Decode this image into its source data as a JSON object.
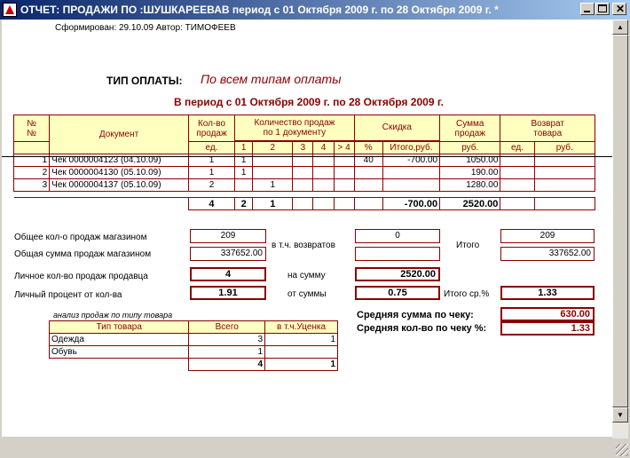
{
  "window": {
    "title": "ОТЧЕТ: ПРОДАЖИ ПО :ШУШКАРЕЕВАВ период с 01 Октября 2009 г. по 28 Октября 2009 г.  *",
    "min_glyph": "",
    "max_glyph": "",
    "close_glyph": "✕"
  },
  "report": {
    "meta": "Сформирован: 29.10.09 Автор: ТИМОФЕЕВ",
    "payment_label": "ТИП ОПЛАТЫ:",
    "payment_value": "По всем типам оплаты",
    "period": "В период с 01 Октября 2009 г. по 28 Октября 2009 г."
  },
  "sales_table": {
    "headers": {
      "num": "№\n№",
      "document": "Документ",
      "qty": "Кол-во\nпродаж",
      "sales_per_doc": "Количество продаж\nпо 1 документу",
      "discount": "Скидка",
      "sum": "Сумма\nпродаж",
      "returns": "Возврат\nтовара"
    },
    "subheaders": {
      "qty_unit": "ед.",
      "p1": "1",
      "p2": "2",
      "p3": "3",
      "p4": "4",
      "p5": "> 4",
      "disc_pct": "%",
      "disc_total": "Итого,руб.",
      "sum_unit": "руб.",
      "ret_unit": "ед.",
      "ret_rub": "руб."
    },
    "rows": [
      {
        "n": "1",
        "doc": "Чек 0000004123 (04.10.09)",
        "qty": "1",
        "p1": "1",
        "p2": "",
        "pct": "40",
        "disc": "-700.00",
        "sum": "1050.00"
      },
      {
        "n": "2",
        "doc": "Чек 0000004130 (05.10.09)",
        "qty": "1",
        "p1": "1",
        "p2": "",
        "pct": "",
        "disc": "",
        "sum": "190.00"
      },
      {
        "n": "3",
        "doc": "Чек 0000004137 (05.10.09)",
        "qty": "2",
        "p1": "",
        "p2": "1",
        "pct": "",
        "disc": "",
        "sum": "1280.00"
      }
    ],
    "totals": {
      "qty": "4",
      "p1": "2",
      "p2": "1",
      "disc": "-700.00",
      "sum": "2520.00"
    }
  },
  "summary": {
    "total_sales_label": "Общее кол-о продаж магазином",
    "total_sales_value": "209",
    "total_sum_label": "Общая сумма продаж магазином",
    "total_sum_value": "337652.00",
    "returns_label": "в т.ч. возвратов",
    "returns_value": "0",
    "itogo_label": "Итого",
    "itogo_count": "209",
    "itogo_sum": "337652.00",
    "seller_sales_label": "Личное кол-во продаж продавца",
    "seller_sales_value": "4",
    "on_sum_label": "на сумму",
    "on_sum_value": "2520.00",
    "pct_count_label": "Личный процент от кол-ва",
    "pct_count_value": "1.91",
    "pct_sum_label": "от суммы",
    "pct_sum_value": "0.75",
    "avg_pct_label": "Итого ср.%",
    "avg_pct_value": "1.33",
    "avg_check_label": "Средняя сумма по чеку:",
    "avg_check_value": "630.00",
    "avg_qty_label": "Средняя кол-во по чеку %:",
    "avg_qty_value": "1.33"
  },
  "type_table": {
    "caption": "анализ продаж по типу товара",
    "headers": {
      "type": "Тип товара",
      "total": "Всего",
      "markdown": "в т.ч.Уценка"
    },
    "rows": [
      {
        "type": "Одежда",
        "total": "3",
        "markdown": "1"
      },
      {
        "type": "Обувь",
        "total": "1",
        "markdown": ""
      }
    ],
    "totals": {
      "total": "4",
      "markdown": "1"
    }
  },
  "scrollbar": {
    "up": "▲",
    "down": "▼"
  }
}
